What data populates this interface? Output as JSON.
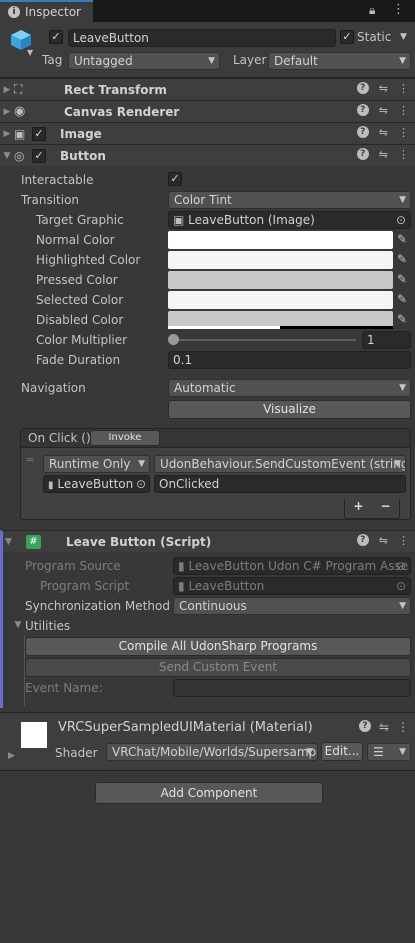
{
  "tab": {
    "title": "Inspector"
  },
  "header": {
    "object_name": "LeaveButton",
    "static_label": "Static",
    "tag_label": "Tag",
    "tag_value": "Untagged",
    "layer_label": "Layer",
    "layer_value": "Default"
  },
  "components": {
    "rect_transform": "Rect Transform",
    "canvas_renderer": "Canvas Renderer",
    "image": "Image",
    "button": "Button"
  },
  "button": {
    "interactable_label": "Interactable",
    "transition_label": "Transition",
    "transition_value": "Color Tint",
    "target_graphic_label": "Target Graphic",
    "target_graphic_value": "LeaveButton (Image)",
    "normal_color_label": "Normal Color",
    "highlighted_color_label": "Highlighted Color",
    "pressed_color_label": "Pressed Color",
    "selected_color_label": "Selected Color",
    "disabled_color_label": "Disabled Color",
    "color_multiplier_label": "Color Multiplier",
    "color_multiplier_value": "1",
    "fade_duration_label": "Fade Duration",
    "fade_duration_value": "0.1",
    "navigation_label": "Navigation",
    "navigation_value": "Automatic",
    "visualize_label": "Visualize",
    "colors": {
      "normal": "#ffffff",
      "highlighted": "#f5f5f5",
      "pressed": "#c8c8c8",
      "selected": "#f5f5f5",
      "disabled": "#c8c8c8"
    }
  },
  "onclick": {
    "title": "On Click ()",
    "invoke_label": "Invoke",
    "runtime_value": "Runtime Only",
    "function_value": "UdonBehaviour.SendCustomEvent (string",
    "object_value": "LeaveButton",
    "argument_value": "OnClicked",
    "add_label": "+",
    "remove_label": "−"
  },
  "script": {
    "title": "Leave Button (Script)",
    "program_source_label": "Program Source",
    "program_source_value": "LeaveButton Udon C# Program Asse",
    "program_script_label": "Program Script",
    "program_script_value": "LeaveButton",
    "sync_method_label": "Synchronization Method",
    "sync_method_value": "Continuous",
    "utilities_label": "Utilities",
    "compile_label": "Compile All UdonSharp Programs",
    "send_event_label": "Send Custom Event",
    "event_name_label": "Event Name:"
  },
  "material": {
    "title": "VRCSuperSampledUIMaterial (Material)",
    "shader_label": "Shader",
    "shader_value": "VRChat/Mobile/Worlds/Supersamp",
    "edit_label": "Edit..."
  },
  "add_component_label": "Add Component"
}
